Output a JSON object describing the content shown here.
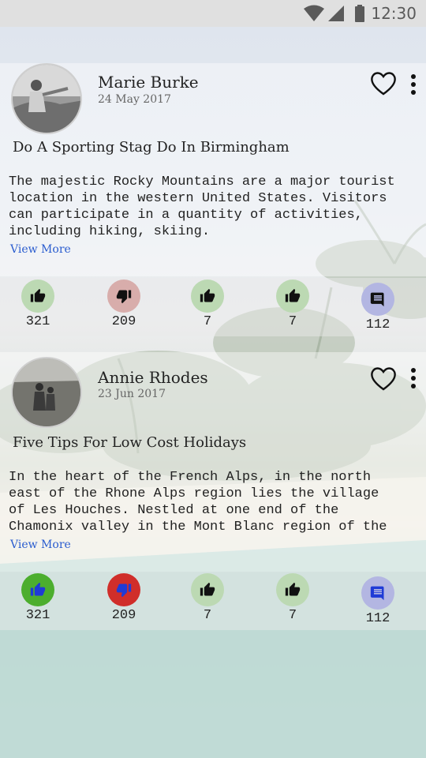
{
  "status_bar": {
    "time": "12:30"
  },
  "posts": [
    {
      "author": "Marie Burke",
      "date": "24 May 2017",
      "title": "Do A Sporting Stag Do In Birmingham",
      "body": "The majestic Rocky Mountains are a major tourist\nlocation in the western United States. Visitors\ncan participate in a quantity of activities,\nincluding hiking, skiing.",
      "view_more": "View More",
      "actions": [
        {
          "icon": "thumb-up-icon",
          "count": "321"
        },
        {
          "icon": "thumb-down-icon",
          "count": "209"
        },
        {
          "icon": "thumb-up-icon",
          "count": "7"
        },
        {
          "icon": "thumb-up-icon",
          "count": "7"
        },
        {
          "icon": "comment-icon",
          "count": "112"
        }
      ]
    },
    {
      "author": "Annie Rhodes",
      "date": "23 Jun 2017",
      "title": "Five Tips For Low Cost Holidays",
      "body": "In the heart of the French Alps, in the north\neast of the Rhone Alps region lies the village\nof Les Houches. Nestled at one end of the\nChamonix valley in the Mont Blanc region of the",
      "view_more": "View More",
      "actions": [
        {
          "icon": "thumb-up-icon",
          "count": "321",
          "active": true,
          "color": "#4cae2e"
        },
        {
          "icon": "thumb-down-icon",
          "count": "209",
          "active": true,
          "color": "#d02e2a"
        },
        {
          "icon": "thumb-up-icon",
          "count": "7"
        },
        {
          "icon": "thumb-up-icon",
          "count": "7"
        },
        {
          "icon": "comment-icon",
          "count": "112"
        }
      ]
    }
  ],
  "colors": {
    "link": "#2a5ccf",
    "like_bg": "#bcd9b3",
    "dislike_bg": "#d8adab",
    "comment_bg": "#b3b6e2",
    "active_icon": "#1f3bd6"
  }
}
